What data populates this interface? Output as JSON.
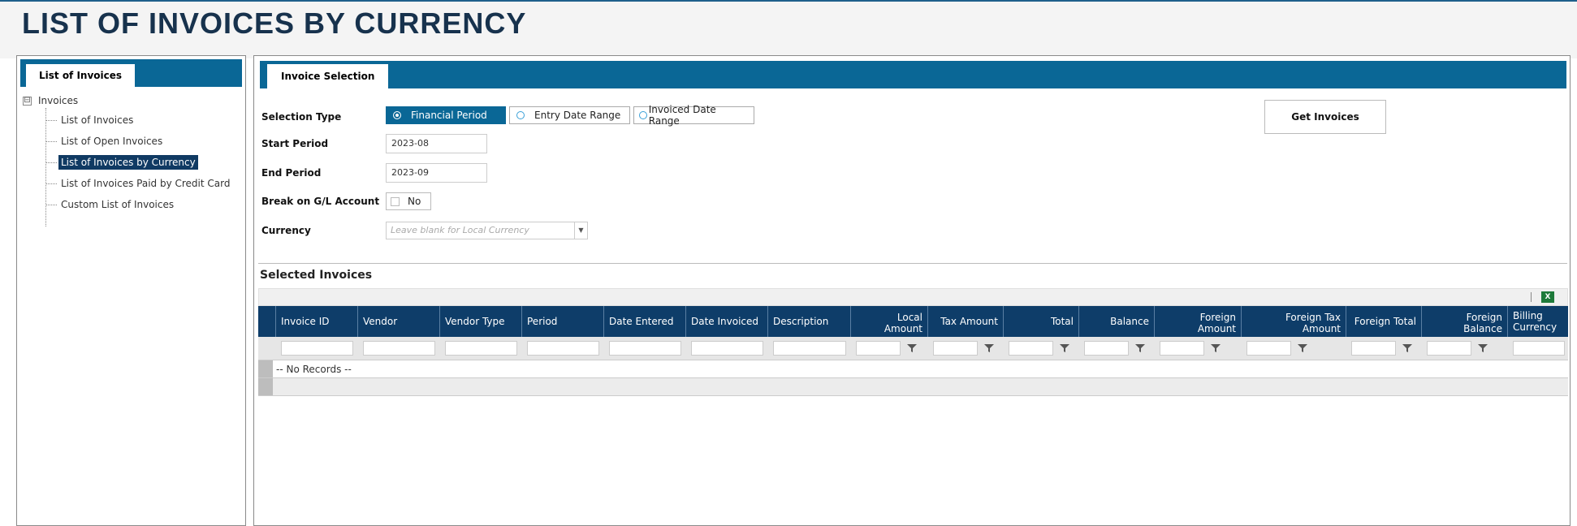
{
  "page": {
    "title": "LIST OF INVOICES BY CURRENCY"
  },
  "left_panel": {
    "tab_label": "List of Invoices",
    "tree": {
      "root_label": "Invoices",
      "expander": "⊟",
      "items": [
        {
          "label": "List of Invoices",
          "selected": false
        },
        {
          "label": "List of Open Invoices",
          "selected": false
        },
        {
          "label": "List of Invoices by Currency",
          "selected": true
        },
        {
          "label": "List of Invoices Paid by Credit Card",
          "selected": false
        },
        {
          "label": "Custom List of Invoices",
          "selected": false
        }
      ]
    }
  },
  "invoice_selection": {
    "tab_label": "Invoice Selection",
    "selection_type_label": "Selection Type",
    "selection_types": [
      {
        "label": "Financial Period",
        "checked": true
      },
      {
        "label": "Entry Date Range",
        "checked": false
      },
      {
        "label": "Invoiced Date Range",
        "checked": false
      }
    ],
    "start_period_label": "Start Period",
    "start_period_value": "2023-08",
    "end_period_label": "End Period",
    "end_period_value": "2023-09",
    "break_on_gl_label": "Break on G/L Account",
    "break_on_gl_value": "No",
    "currency_label": "Currency",
    "currency_placeholder": "Leave blank for Local Currency",
    "get_invoices_button": "Get Invoices"
  },
  "selected_invoices": {
    "title": "Selected Invoices",
    "export_icon": "excel-icon",
    "columns": [
      "Invoice ID",
      "Vendor",
      "Vendor Type",
      "Period",
      "Date Entered",
      "Date Invoiced",
      "Description",
      "Local Amount",
      "Tax Amount",
      "Total",
      "Balance",
      "Foreign Amount",
      "Foreign Tax Amount",
      "Foreign Total",
      "Foreign Balance",
      "Billing Currency"
    ],
    "no_records_text": "-- No Records --"
  },
  "colors": {
    "tab_bar": "#0a6796",
    "grid_header": "#0e3d69",
    "selected_item": "#103a63",
    "title": "#17324d",
    "excel_green": "#1e7a3a"
  }
}
